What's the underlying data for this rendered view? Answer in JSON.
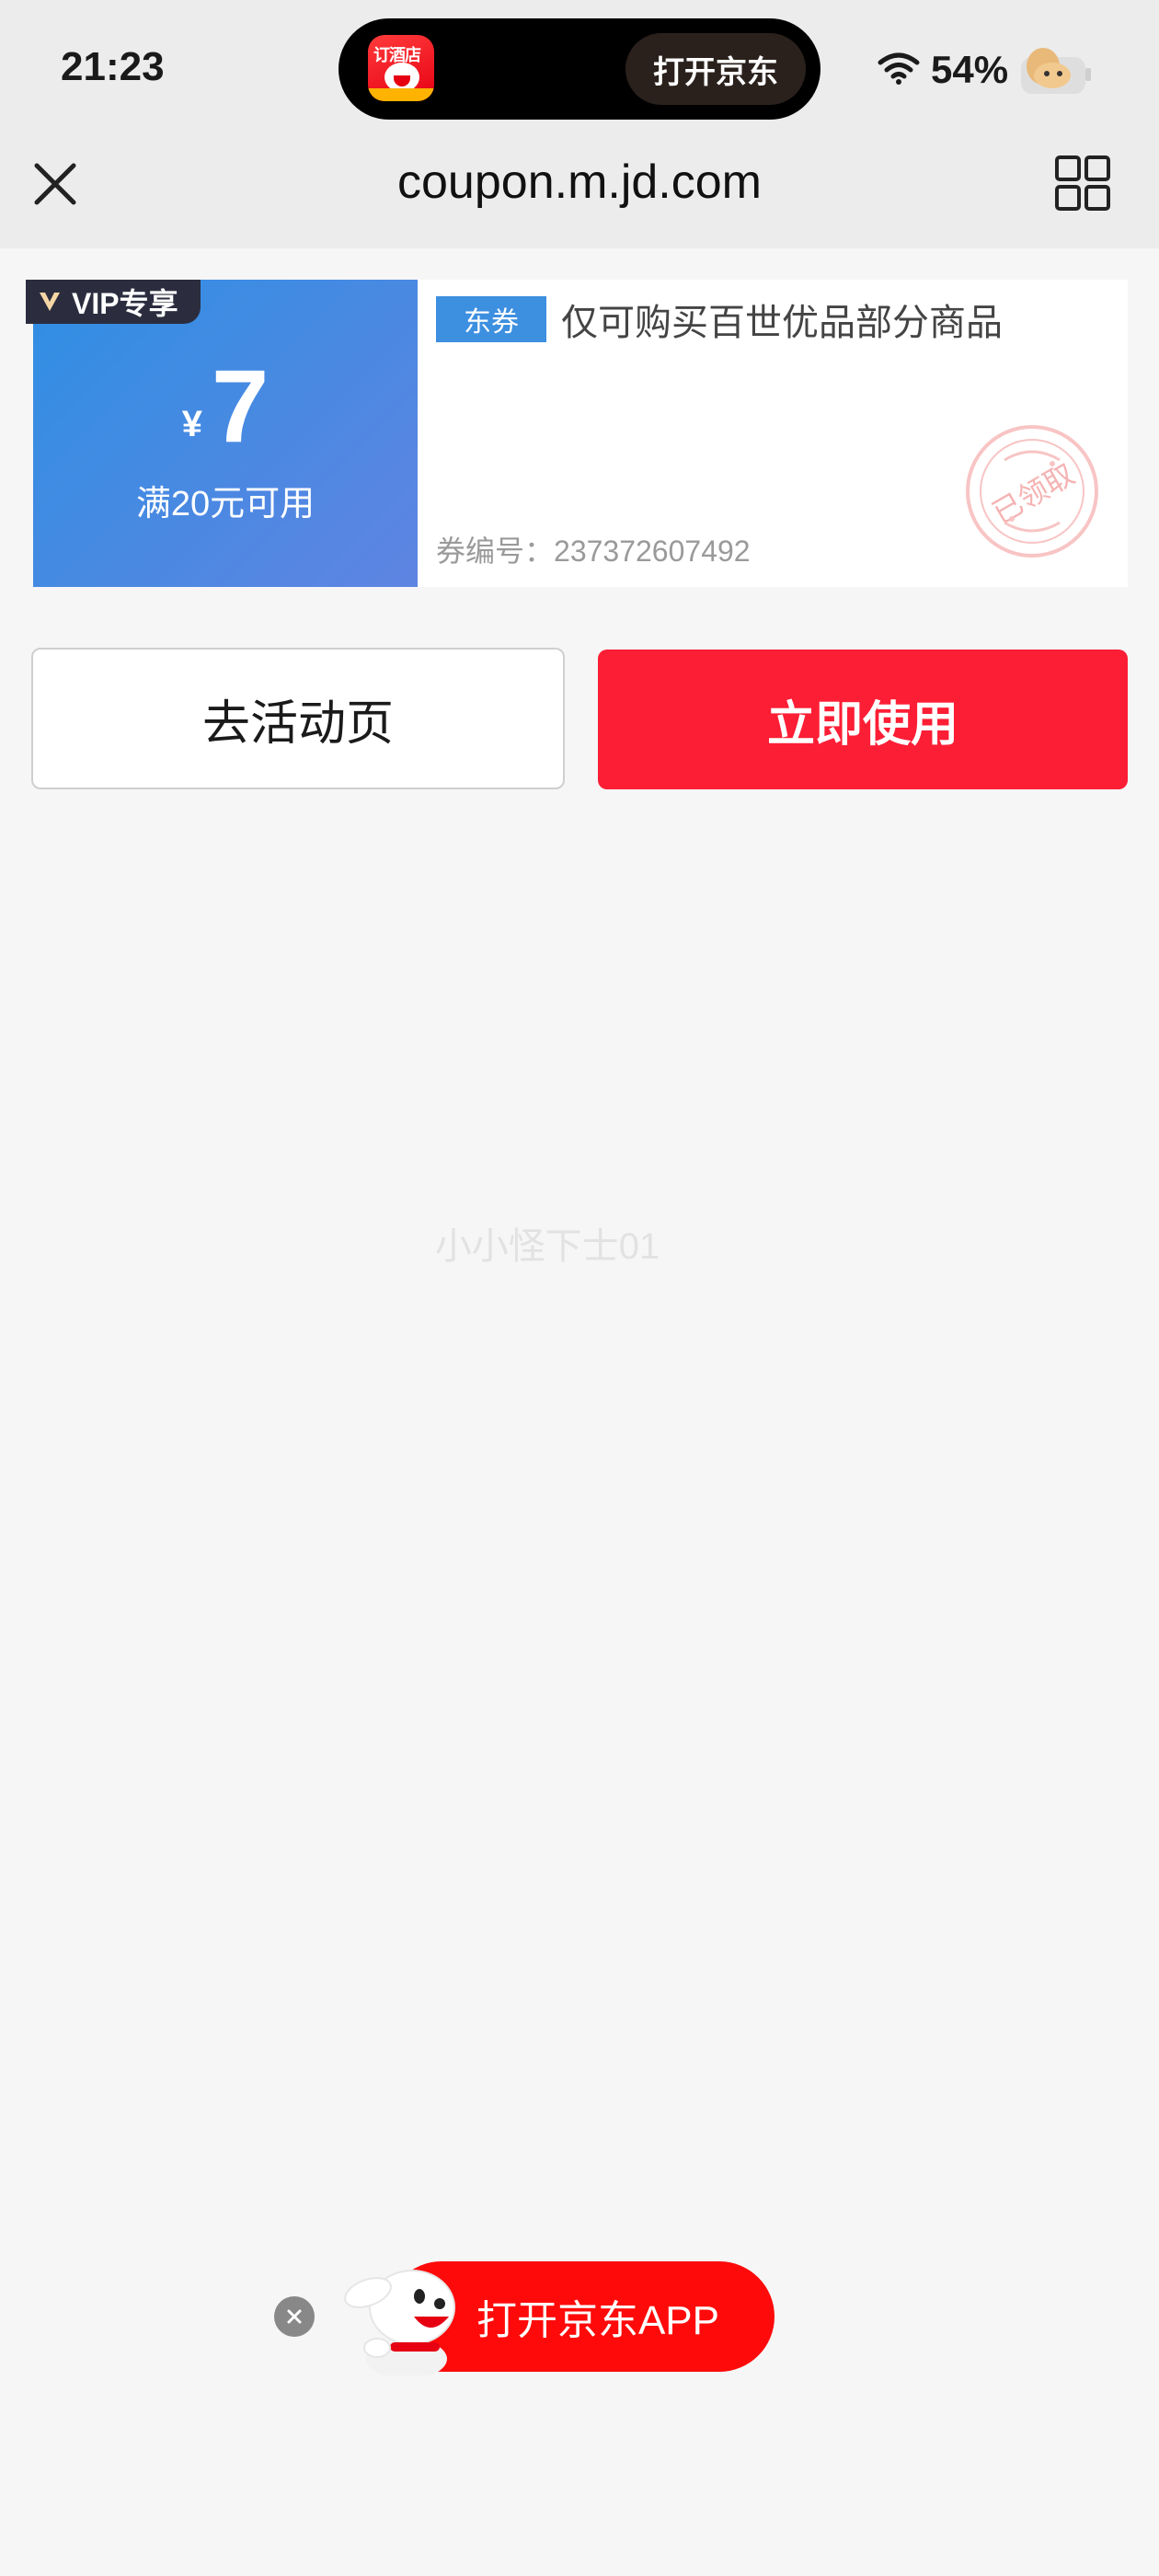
{
  "status_bar": {
    "time": "21:23",
    "island_button": "打开京东",
    "island_app_icon_text": "订酒店",
    "battery": "54%"
  },
  "browser": {
    "url": "coupon.m.jd.com",
    "close_icon": "close-icon",
    "menu_icon": "grid-icon"
  },
  "coupon": {
    "badge": "VIP专享",
    "currency_symbol": "¥",
    "amount": "7",
    "condition": "满20元可用",
    "tag": "东券",
    "description": "仅可购买百世优品部分商品",
    "code_label": "券编号：",
    "code": "237372607492",
    "stamp_text": "已领取",
    "left_gradient": [
      "#2f8fe3",
      "#5f84e2"
    ],
    "tag_color": "#3d8fe0"
  },
  "actions": {
    "activity_label": "去活动页",
    "use_label": "立即使用",
    "use_color": "#fc1e35"
  },
  "watermark": "小小怪下士01",
  "app_banner": {
    "label": "打开京东APP",
    "color": "#ff0a0a"
  }
}
